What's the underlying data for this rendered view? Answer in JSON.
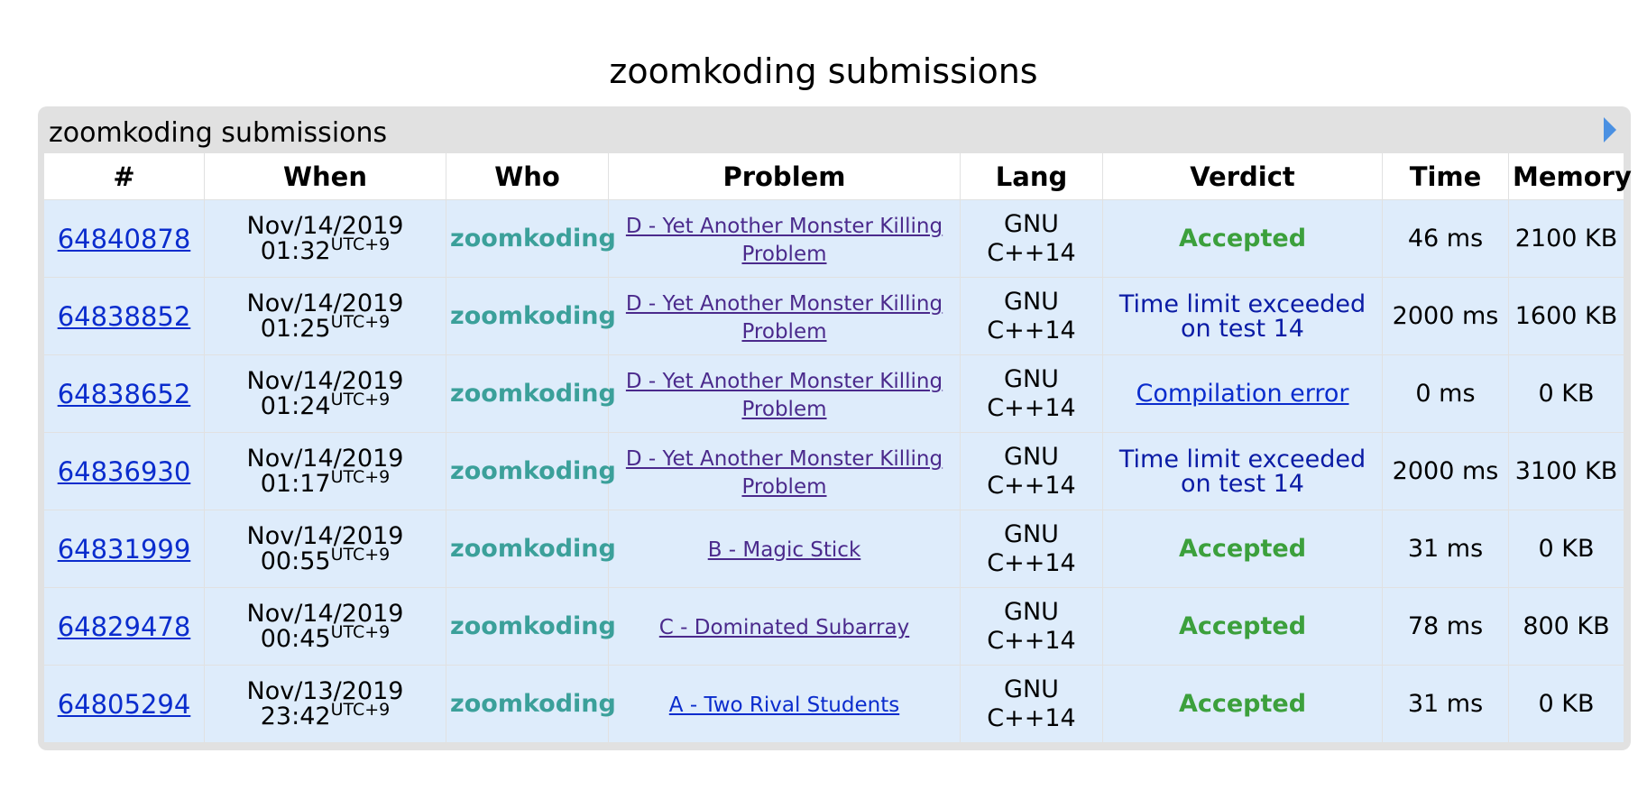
{
  "page": {
    "title": "zoomkoding submissions",
    "panel_caption": "zoomkoding submissions"
  },
  "table": {
    "headers": [
      "#",
      "When",
      "Who",
      "Problem",
      "Lang",
      "Verdict",
      "Time",
      "Memory"
    ],
    "rows": [
      {
        "id": "64840878",
        "date": "Nov/14/2019",
        "time": "01:32",
        "tz": "UTC+9",
        "who": "zoomkoding",
        "problem": "D - Yet Another Monster Killing Problem",
        "lang1": "GNU",
        "lang2": "C++14",
        "verdict": "Accepted",
        "run_time": "46 ms",
        "memory": "2100 KB"
      },
      {
        "id": "64838852",
        "date": "Nov/14/2019",
        "time": "01:25",
        "tz": "UTC+9",
        "who": "zoomkoding",
        "problem": "D - Yet Another Monster Killing Problem",
        "lang1": "GNU",
        "lang2": "C++14",
        "verdict": "Time limit exceeded on test 14",
        "run_time": "2000 ms",
        "memory": "1600 KB"
      },
      {
        "id": "64838652",
        "date": "Nov/14/2019",
        "time": "01:24",
        "tz": "UTC+9",
        "who": "zoomkoding",
        "problem": "D - Yet Another Monster Killing Problem",
        "lang1": "GNU",
        "lang2": "C++14",
        "verdict": "Compilation error",
        "run_time": "0 ms",
        "memory": "0 KB"
      },
      {
        "id": "64836930",
        "date": "Nov/14/2019",
        "time": "01:17",
        "tz": "UTC+9",
        "who": "zoomkoding",
        "problem": "D - Yet Another Monster Killing Problem",
        "lang1": "GNU",
        "lang2": "C++14",
        "verdict": "Time limit exceeded on test 14",
        "run_time": "2000 ms",
        "memory": "3100 KB"
      },
      {
        "id": "64831999",
        "date": "Nov/14/2019",
        "time": "00:55",
        "tz": "UTC+9",
        "who": "zoomkoding",
        "problem": "B - Magic Stick",
        "lang1": "GNU",
        "lang2": "C++14",
        "verdict": "Accepted",
        "run_time": "31 ms",
        "memory": "0 KB"
      },
      {
        "id": "64829478",
        "date": "Nov/14/2019",
        "time": "00:45",
        "tz": "UTC+9",
        "who": "zoomkoding",
        "problem": "C - Dominated Subarray",
        "lang1": "GNU",
        "lang2": "C++14",
        "verdict": "Accepted",
        "run_time": "78 ms",
        "memory": "800 KB"
      },
      {
        "id": "64805294",
        "date": "Nov/13/2019",
        "time": "23:42",
        "tz": "UTC+9",
        "who": "zoomkoding",
        "problem": "A - Two Rival Students",
        "lang1": "GNU",
        "lang2": "C++14",
        "verdict": "Accepted",
        "run_time": "31 ms",
        "memory": "0 KB"
      }
    ]
  },
  "colors": {
    "link": "#0a2ccd",
    "visited_link": "#4b2a8c",
    "accepted": "#3ca03c",
    "user": "#3ba09a",
    "row_bg": "#deecfb"
  }
}
